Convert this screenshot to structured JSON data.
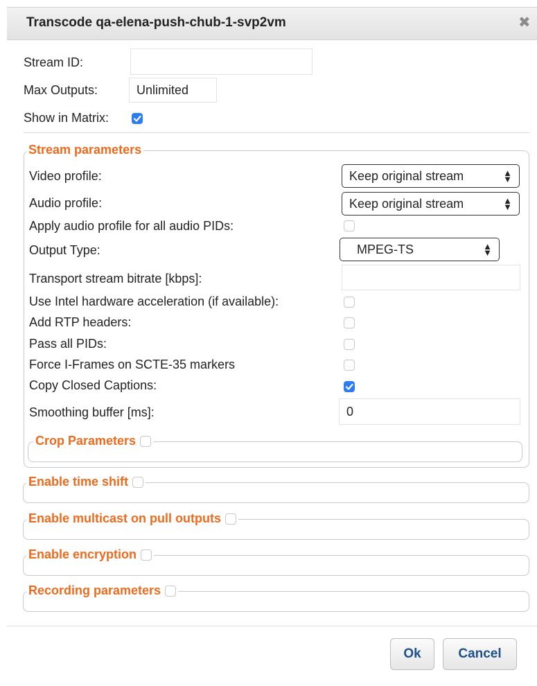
{
  "dialog": {
    "title": "Transcode qa-elena-push-chub-1-svp2vm",
    "close_glyph": "✖"
  },
  "top_fields": {
    "stream_id_label": "Stream ID:",
    "stream_id_value": "",
    "max_outputs_label": "Max Outputs:",
    "max_outputs_value": "Unlimited",
    "show_in_matrix_label": "Show in Matrix:",
    "show_in_matrix_checked": true
  },
  "stream_parameters": {
    "legend": "Stream parameters",
    "video_profile_label": "Video profile:",
    "video_profile_value": "Keep original stream",
    "audio_profile_label": "Audio profile:",
    "audio_profile_value": "Keep original stream",
    "apply_audio_label": "Apply audio profile for all audio PIDs:",
    "output_type_label": "Output Type:",
    "output_type_value": "MPEG-TS",
    "ts_bitrate_label": "Transport stream bitrate [kbps]:",
    "ts_bitrate_value": "",
    "intel_hw_label": "Use Intel hardware acceleration (if available):",
    "rtp_headers_label": "Add RTP headers:",
    "pass_pids_label": "Pass all PIDs:",
    "force_iframes_label": "Force I-Frames on SCTE-35 markers",
    "closed_captions_label": "Copy Closed Captions:",
    "closed_captions_checked": true,
    "smoothing_label": "Smoothing buffer [ms]:",
    "smoothing_value": "0",
    "crop_legend": "Crop Parameters"
  },
  "sections": {
    "time_shift": "Enable time shift",
    "multicast": "Enable multicast on pull outputs",
    "encryption": "Enable encryption",
    "recording": "Recording parameters"
  },
  "buttons": {
    "ok": "Ok",
    "cancel": "Cancel"
  },
  "colors": {
    "legend_orange": "#ec6b1e",
    "checkbox_blue": "#2f7cf0",
    "button_text": "#1d4f8c"
  }
}
